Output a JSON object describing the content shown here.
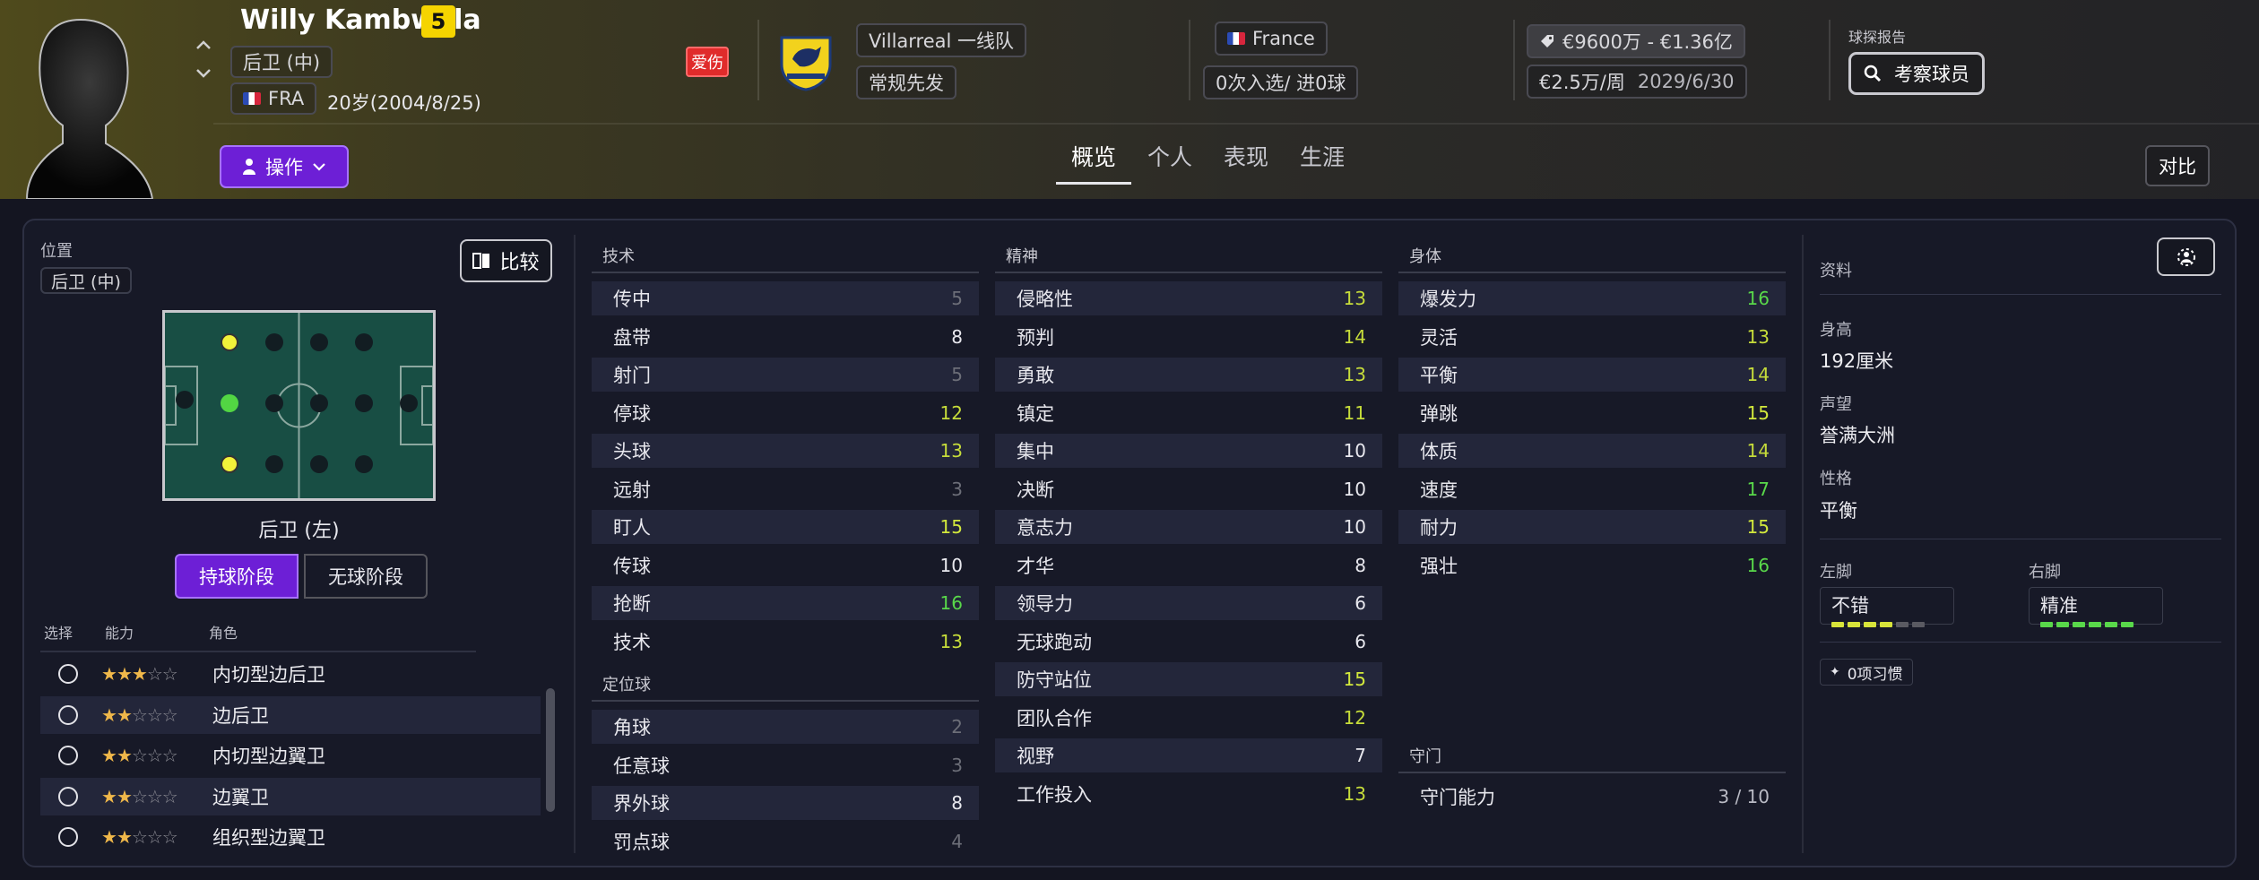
{
  "player": {
    "name": "Willy Kambwala",
    "number": "5",
    "position": "后卫 (中)",
    "nationality_code": "FRA",
    "age_dob": "20岁(2004/8/25)",
    "injury": "爱伤",
    "action_button": "操作"
  },
  "club": {
    "team": "Villarreal 一线队",
    "status": "常规先发",
    "country": "France",
    "caps": "0次入选/ 进0球"
  },
  "contract": {
    "value": "€9600万 - €1.36亿",
    "wage": "€2.5万/周",
    "expiry": "2029/6/30"
  },
  "scout": {
    "label": "球探报告",
    "button": "考察球员"
  },
  "tabs": [
    "概览",
    "个人",
    "表现",
    "生涯"
  ],
  "compare_button": "对比",
  "left": {
    "position_label": "位置",
    "position_value": "后卫 (中)",
    "compare_button": "比较",
    "pitch_caption": "后卫 (左)",
    "phase_in": "持球阶段",
    "phase_out": "无球阶段",
    "col_select": "选择",
    "col_ability": "能力",
    "col_role": "角色",
    "roles": [
      {
        "name": "内切型边后卫",
        "stars": 3
      },
      {
        "name": "边后卫",
        "stars": 2
      },
      {
        "name": "内切型边翼卫",
        "stars": 2
      },
      {
        "name": "边翼卫",
        "stars": 2
      },
      {
        "name": "组织型边翼卫",
        "stars": 2
      }
    ]
  },
  "technical": {
    "title": "技术",
    "items": [
      {
        "name": "传中",
        "value": "5",
        "color": "#6c6e78"
      },
      {
        "name": "盘带",
        "value": "8",
        "color": "#e8e8ee"
      },
      {
        "name": "射门",
        "value": "5",
        "color": "#6c6e78"
      },
      {
        "name": "停球",
        "value": "12",
        "color": "#c6dc3a"
      },
      {
        "name": "头球",
        "value": "13",
        "color": "#c6dc3a"
      },
      {
        "name": "远射",
        "value": "3",
        "color": "#6c6e78"
      },
      {
        "name": "盯人",
        "value": "15",
        "color": "#d2e83c"
      },
      {
        "name": "传球",
        "value": "10",
        "color": "#e8e8ee"
      },
      {
        "name": "抢断",
        "value": "16",
        "color": "#59d84a"
      },
      {
        "name": "技术",
        "value": "13",
        "color": "#c6dc3a"
      }
    ]
  },
  "setpieces": {
    "title": "定位球",
    "items": [
      {
        "name": "角球",
        "value": "2",
        "color": "#6c6e78"
      },
      {
        "name": "任意球",
        "value": "3",
        "color": "#6c6e78"
      },
      {
        "name": "界外球",
        "value": "8",
        "color": "#e8e8ee"
      },
      {
        "name": "罚点球",
        "value": "4",
        "color": "#6c6e78"
      }
    ]
  },
  "mental": {
    "title": "精神",
    "items": [
      {
        "name": "侵略性",
        "value": "13",
        "color": "#c6dc3a"
      },
      {
        "name": "预判",
        "value": "14",
        "color": "#c6dc3a"
      },
      {
        "name": "勇敢",
        "value": "13",
        "color": "#c6dc3a"
      },
      {
        "name": "镇定",
        "value": "11",
        "color": "#c6dc3a"
      },
      {
        "name": "集中",
        "value": "10",
        "color": "#e8e8ee"
      },
      {
        "name": "决断",
        "value": "10",
        "color": "#e8e8ee"
      },
      {
        "name": "意志力",
        "value": "10",
        "color": "#e8e8ee"
      },
      {
        "name": "才华",
        "value": "8",
        "color": "#e8e8ee"
      },
      {
        "name": "领导力",
        "value": "6",
        "color": "#e8e8ee"
      },
      {
        "name": "无球跑动",
        "value": "6",
        "color": "#e8e8ee"
      },
      {
        "name": "防守站位",
        "value": "15",
        "color": "#d2e83c"
      },
      {
        "name": "团队合作",
        "value": "12",
        "color": "#c6dc3a"
      },
      {
        "name": "视野",
        "value": "7",
        "color": "#e8e8ee"
      },
      {
        "name": "工作投入",
        "value": "13",
        "color": "#c6dc3a"
      }
    ]
  },
  "physical": {
    "title": "身体",
    "items": [
      {
        "name": "爆发力",
        "value": "16",
        "color": "#59d84a"
      },
      {
        "name": "灵活",
        "value": "13",
        "color": "#c6dc3a"
      },
      {
        "name": "平衡",
        "value": "14",
        "color": "#c6dc3a"
      },
      {
        "name": "弹跳",
        "value": "15",
        "color": "#d2e83c"
      },
      {
        "name": "体质",
        "value": "14",
        "color": "#c6dc3a"
      },
      {
        "name": "速度",
        "value": "17",
        "color": "#59d84a"
      },
      {
        "name": "耐力",
        "value": "15",
        "color": "#d2e83c"
      },
      {
        "name": "强壮",
        "value": "16",
        "color": "#59d84a"
      }
    ]
  },
  "goalkeeping": {
    "title": "守门",
    "name": "守门能力",
    "value": "3 / 10"
  },
  "info": {
    "title": "资料",
    "height_label": "身高",
    "height": "192厘米",
    "reputation_label": "声望",
    "reputation": "誉满大洲",
    "personality_label": "性格",
    "personality": "平衡",
    "left_foot_label": "左脚",
    "left_foot": "不错",
    "left_foot_level": 4,
    "right_foot_label": "右脚",
    "right_foot": "精准",
    "right_foot_level": 6,
    "habits": "0项习惯"
  },
  "icons": {
    "sort": "chevron-up-down-icon",
    "club_badge": "villarreal-crest-icon",
    "tag": "price-tag-icon",
    "search": "search-icon",
    "person": "person-icon",
    "chevron": "chevron-down-icon",
    "compare": "compare-icon",
    "settings": "settings-icon",
    "sparkle": "sparkle-icon"
  }
}
